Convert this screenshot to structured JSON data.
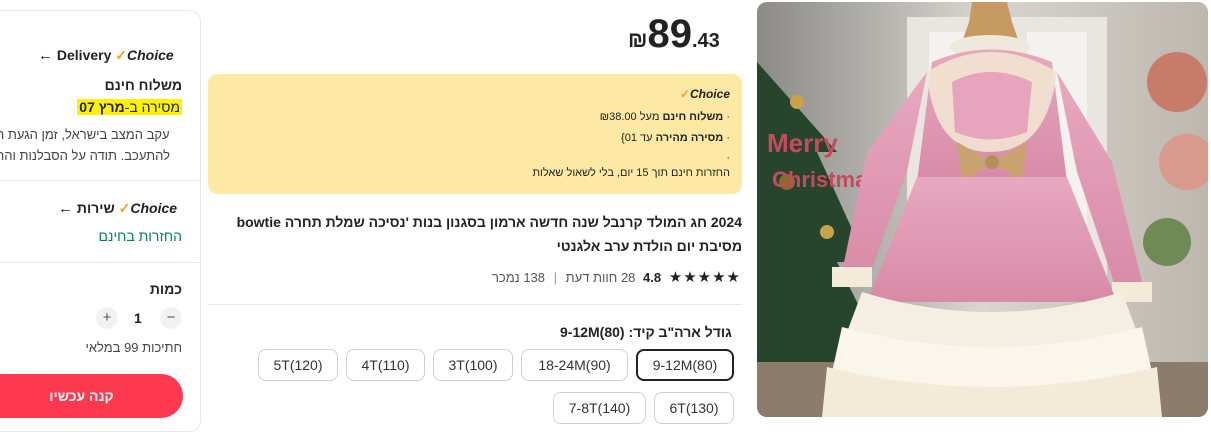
{
  "delivery": {
    "title": "Delivery",
    "choice_label": "Choice",
    "free_shipping": "משלוח חינם",
    "delivery_by_prefix": "מסירה ב-",
    "delivery_date": "מרץ 07",
    "note_line1": "עקב המצב בישראל, זמן הגעת ה",
    "note_line2": "להתעכב. תודה על הסבלנות והה"
  },
  "service": {
    "label": "שירות",
    "choice_label": "Choice",
    "free_returns": "החזרות בחינם"
  },
  "quantity": {
    "label": "כמות",
    "value": "1",
    "minus": "−",
    "plus": "+",
    "stock": "חתיכות 99 במלאי"
  },
  "buy_now": "קנה עכשיו",
  "price": {
    "currency": "₪",
    "integer": "89",
    "decimal": ".43"
  },
  "choice_box": {
    "brand": "Choice",
    "line1_prefix": "מעל ₪38.00",
    "line1_bold": "משלוח חינם",
    "line2_bold": "מסירה מהירה",
    "line2_suffix": "עד 01}",
    "line3": "",
    "line4": "החזרות חינם תוך 15 יום, בלי לשאול שאלות"
  },
  "product_title": "2024 חג המולד קרנבל שנה חדשה ארמון בסגנון בנות 'נסיכה שמלת תחרה bowtie מסיבת יום הולדת ערב אלגנטי",
  "rating": {
    "stars": "★★★★★",
    "score": "4.8",
    "reviews": "28 חוות דעת",
    "separator": "|",
    "sold": "138 נמכר"
  },
  "size": {
    "label": "גודל ארה\"ב קיד: (9-12M(80",
    "options": [
      "9-12M(80)",
      "18-24M(90)",
      "3T(100)",
      "4T(110)",
      "5T(120)",
      "6T(130)",
      "7-8T(140)"
    ],
    "selected": "9-12M(80)"
  },
  "icons": {
    "arrow": "arrow-left-icon",
    "check": "choice-check-icon"
  },
  "colors": {
    "buy_button": "#fd384f",
    "choice_box_bg": "#fde9a3",
    "highlight": "#fff200",
    "free_returns_green": "#00864b"
  }
}
